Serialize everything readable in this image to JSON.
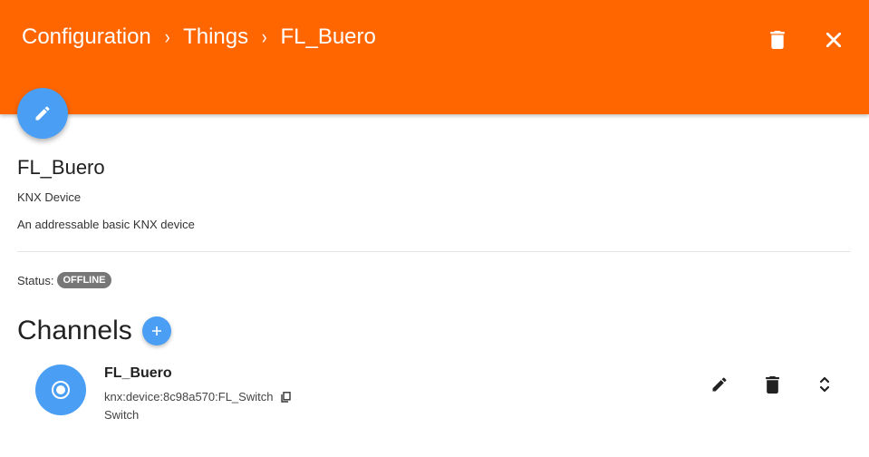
{
  "header": {
    "breadcrumb": [
      "Configuration",
      "Things",
      "FL_Buero"
    ],
    "separator": "›",
    "color": "#ff6600"
  },
  "icons": {
    "delete": "trash-icon",
    "close": "close-icon",
    "edit": "pencil-icon",
    "add": "plus-icon",
    "channel": "radio-target-icon",
    "copy": "copy-icon",
    "expand": "unfold-icon"
  },
  "thing": {
    "name": "FL_Buero",
    "type": "KNX Device",
    "description": "An addressable basic KNX device",
    "status_label": "Status:",
    "status": "OFFLINE"
  },
  "channels": {
    "title": "Channels",
    "add_label": "+",
    "items": [
      {
        "name": "FL_Buero",
        "uid": "knx:device:8c98a570:FL_Switch",
        "type": "Switch"
      }
    ]
  },
  "colors": {
    "accent": "#4a9ff5",
    "badge": "#777777"
  }
}
